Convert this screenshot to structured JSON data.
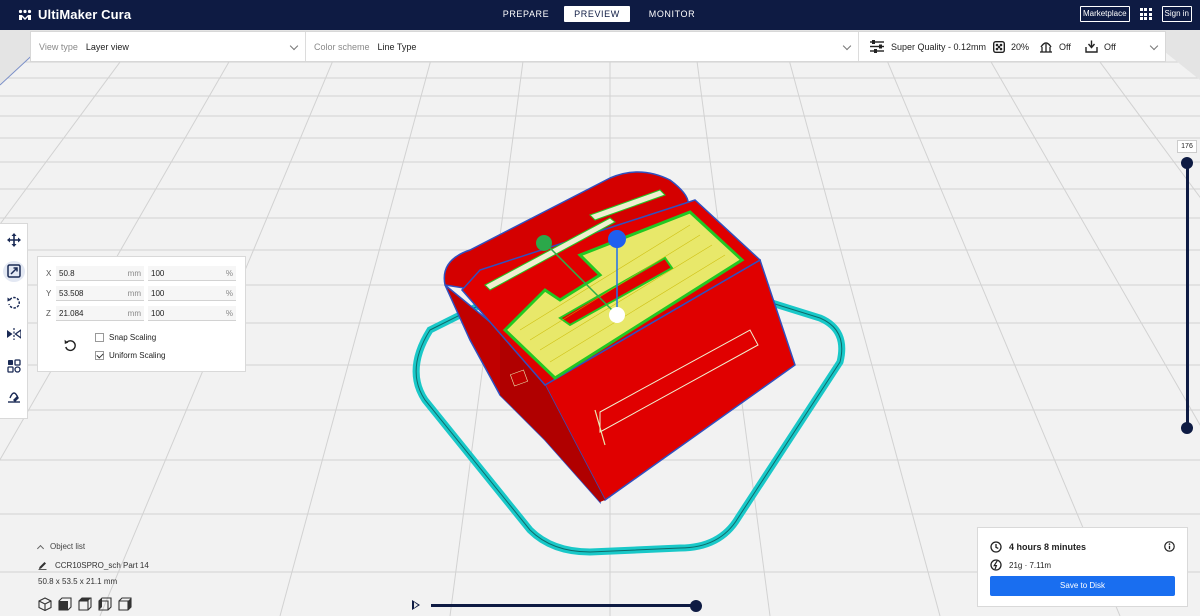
{
  "app": {
    "name": "UltiMaker Cura"
  },
  "nav": {
    "tabs": [
      "PREPARE",
      "PREVIEW",
      "MONITOR"
    ],
    "active": "PREVIEW"
  },
  "topbar": {
    "marketplace_label": "Marketplace",
    "signin_label": "Sign in"
  },
  "settings_bar": {
    "view_type_label": "View type",
    "view_type_value": "Layer view",
    "color_scheme_label": "Color scheme",
    "color_scheme_value": "Line Type",
    "profile": "Super Quality - 0.12mm",
    "infill": "20%",
    "support": "Off",
    "adhesion": "Off"
  },
  "scale_panel": {
    "rows": [
      {
        "axis": "X",
        "mm": "50.8",
        "percent": "100"
      },
      {
        "axis": "Y",
        "mm": "53.508",
        "percent": "100"
      },
      {
        "axis": "Z",
        "mm": "21.084",
        "percent": "100"
      }
    ],
    "unit_mm": "mm",
    "unit_percent": "%",
    "snap_scaling_label": "Snap Scaling",
    "snap_scaling_checked": false,
    "uniform_scaling_label": "Uniform Scaling",
    "uniform_scaling_checked": true
  },
  "layer_slider": {
    "current_layer": "176"
  },
  "object_list": {
    "header": "Object list",
    "object_name": "CCR10SPRO_sch Part 14",
    "dimensions": "50.8 x 53.5 x 21.1 mm"
  },
  "estimate": {
    "time": "4 hours 8 minutes",
    "material": "21g · 7.11m",
    "save_label": "Save to Disk"
  },
  "colors": {
    "topbar": "#0e1b43",
    "accent": "#196ef0",
    "model_wall": "#e00000",
    "model_top": "#e8e86a",
    "model_inner_wall": "#22c822",
    "skirt": "#19c8c8"
  }
}
